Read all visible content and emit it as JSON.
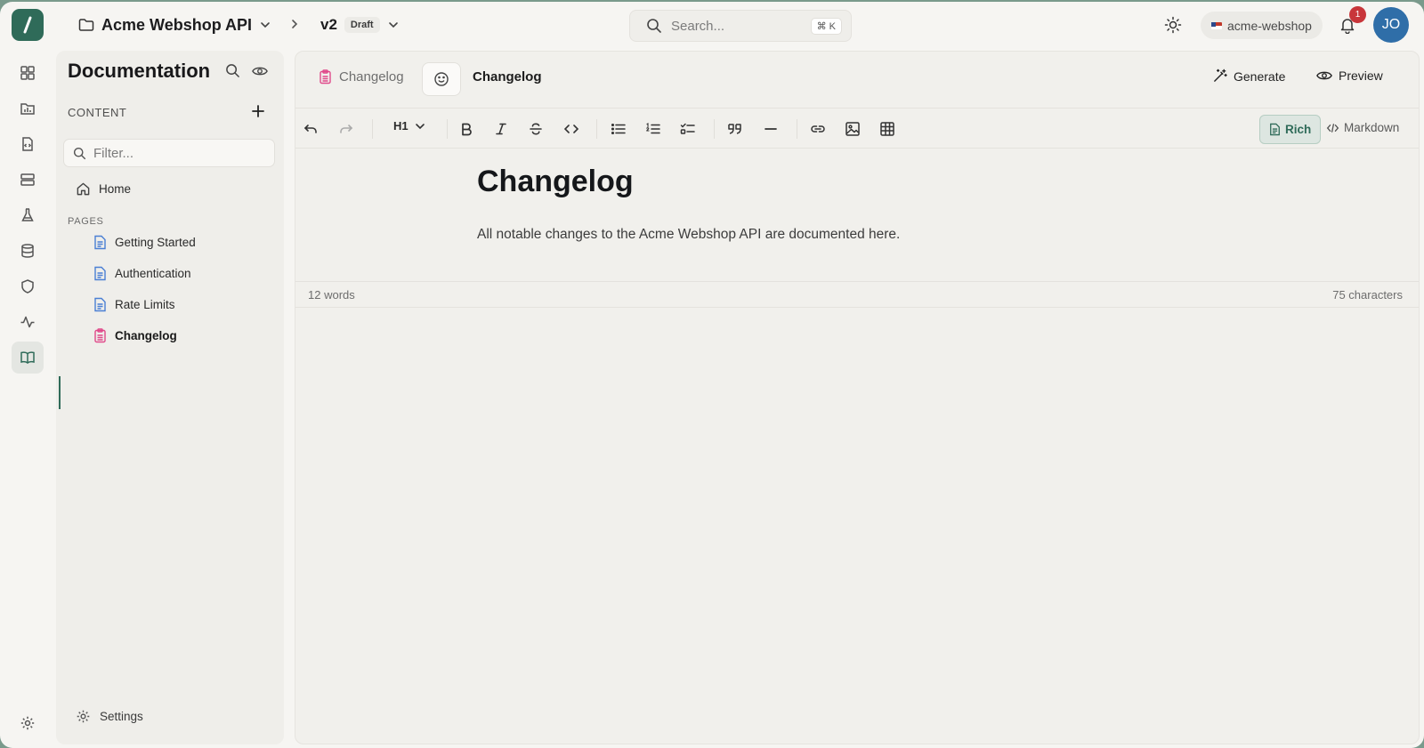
{
  "topbar": {
    "project_title": "Acme Webshop API",
    "version": "v2",
    "version_status": "Draft",
    "search_placeholder": "Search...",
    "search_shortcut": "⌘ K",
    "org_name": "acme-webshop",
    "notification_count": "1",
    "avatar_initials": "JO"
  },
  "rail": {
    "items": [
      "dashboard-icon",
      "folder-chart-icon",
      "file-code-icon",
      "server-icon",
      "flask-icon",
      "database-icon",
      "shield-icon",
      "activity-icon",
      "book-icon"
    ],
    "active": "book-icon"
  },
  "sidebar": {
    "title": "Documentation",
    "section_label": "CONTENT",
    "filter_placeholder": "Filter...",
    "home_label": "Home",
    "pages_label": "PAGES",
    "pages": [
      {
        "label": "Getting Started"
      },
      {
        "label": "Authentication"
      },
      {
        "label": "Rate Limits"
      },
      {
        "label": "Changelog"
      }
    ],
    "settings_label": "Settings"
  },
  "editor": {
    "crumb_label": "Changelog",
    "page_name": "Changelog",
    "generate_label": "Generate",
    "preview_label": "Preview",
    "heading_level": "H1",
    "mode_rich_label": "Rich",
    "mode_markdown_label": "Markdown",
    "doc_title": "Changelog",
    "doc_body": "All notable changes to the Acme Webshop API are documented here.",
    "word_count": "12 words",
    "char_count": "75 characters"
  },
  "colors": {
    "brand": "#2f6b59",
    "changelog_accent": "#e0498a",
    "page_icon_blue": "#4a7fd4",
    "notification": "#c8363a",
    "avatar": "#2f6ea8"
  }
}
